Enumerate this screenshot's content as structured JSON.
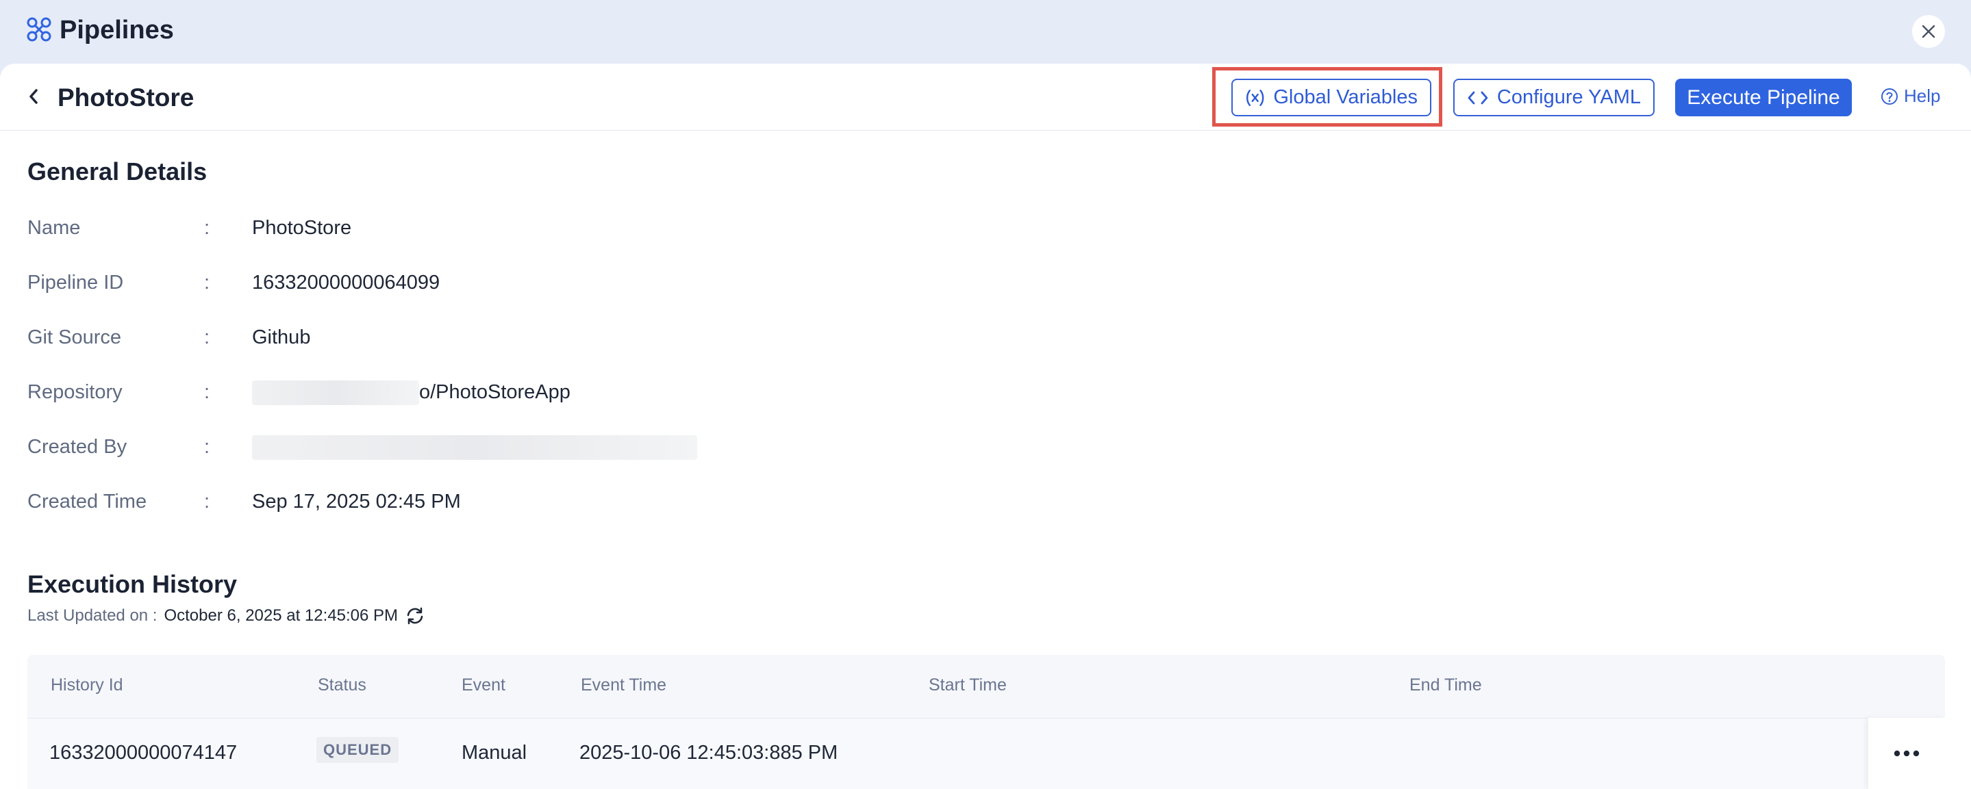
{
  "app": {
    "title": "Pipelines"
  },
  "header": {
    "title": "PhotoStore",
    "global_variables_label": "Global Variables",
    "configure_yaml_label": "Configure YAML",
    "execute_label": "Execute Pipeline",
    "help_label": "Help"
  },
  "details": {
    "title": "General Details",
    "rows": [
      {
        "label": "Name",
        "value": "PhotoStore"
      },
      {
        "label": "Pipeline ID",
        "value": "16332000000064099"
      },
      {
        "label": "Git Source",
        "value": "Github"
      },
      {
        "label": "Repository",
        "value": "o/PhotoStoreApp"
      },
      {
        "label": "Created By",
        "value": ""
      },
      {
        "label": "Created Time",
        "value": "Sep 17, 2025 02:45 PM"
      }
    ],
    "separator": ":"
  },
  "execution": {
    "title": "Execution History",
    "last_updated_label": "Last Updated on :",
    "last_updated_value": "October 6, 2025 at 12:45:06 PM",
    "columns": [
      "History Id",
      "Status",
      "Event",
      "Event Time",
      "Start Time",
      "End Time"
    ],
    "rows": [
      {
        "history_id": "16332000000074147",
        "status": "QUEUED",
        "event": "Manual",
        "event_time": "2025-10-06 12:45:03:885 PM",
        "start_time": "",
        "end_time": ""
      }
    ]
  },
  "icons": {
    "app": "pipelines-icon",
    "close": "close-icon",
    "back": "chevron-left-icon",
    "global_variables": "variable-icon",
    "configure_yaml": "code-icon",
    "help": "help-circle-icon",
    "refresh": "refresh-icon",
    "more": "more-horizontal-icon"
  },
  "colors": {
    "accent": "#2f64e0",
    "highlight": "#e0554d",
    "topbar": "#e6ebf8"
  }
}
